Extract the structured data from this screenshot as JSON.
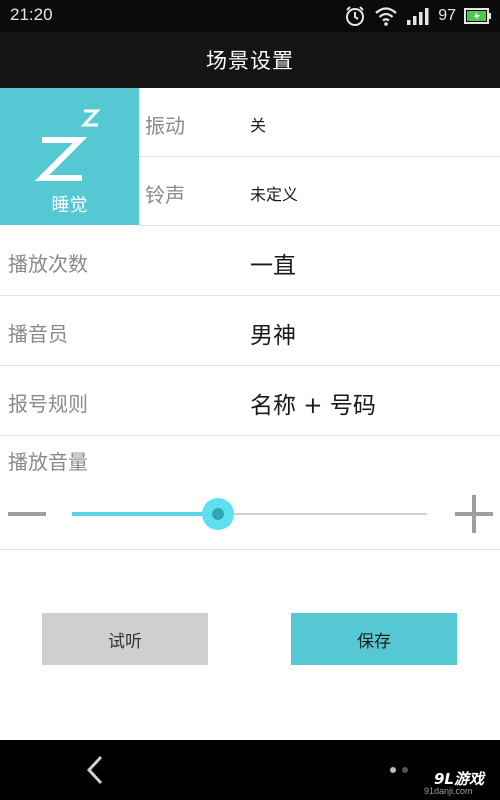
{
  "status_bar": {
    "time": "21:20",
    "battery": "97"
  },
  "header": {
    "title": "场景设置"
  },
  "scene": {
    "icon": "sleep-zz-icon",
    "label": "睡觉",
    "color": "#56c8d4"
  },
  "settings": {
    "vibration": {
      "label": "振动",
      "value": "关"
    },
    "ringtone": {
      "label": "铃声",
      "value": "未定义"
    },
    "play_count": {
      "label": "播放次数",
      "value": "一直"
    },
    "announcer": {
      "label": "播音员",
      "value": "男神"
    },
    "number_rule": {
      "label": "报号规则",
      "value": "名称 + 号码"
    }
  },
  "volume": {
    "label": "播放音量",
    "level": 0.41
  },
  "buttons": {
    "test": "试听",
    "save": "保存"
  },
  "watermark": {
    "logo": "9L游戏",
    "url": "91danji.com"
  }
}
